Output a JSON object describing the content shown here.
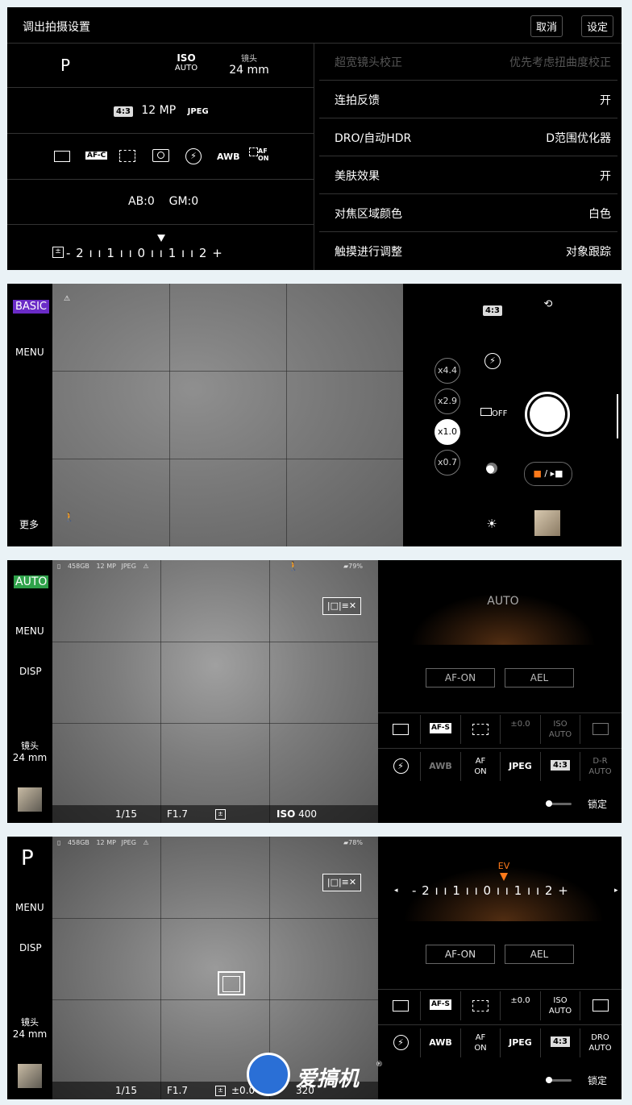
{
  "panel1": {
    "title": "调出拍摄设置",
    "cancel": "取消",
    "set": "设定",
    "mode": "P",
    "iso_label": "ISO",
    "iso_value": "AUTO",
    "lens_label": "镜头",
    "lens_value": "24 mm",
    "aspect": "4:3",
    "megapixels": "12 MP",
    "format": "JPEG",
    "afc": "AF-C",
    "awb": "AWB",
    "af_on_label": "AF\nON",
    "white_balance_shift": "AB:0    GM:0",
    "ev_scale": "- 2 ı ı 1 ı ı 0 ı ı 1 ı ı 2 +",
    "settings": [
      {
        "label": "超宽镜头校正",
        "value": "优先考虑扭曲度校正",
        "disabled": true
      },
      {
        "label": "连拍反馈",
        "value": "开",
        "disabled": false
      },
      {
        "label": "DRO/自动HDR",
        "value": "D范围优化器",
        "disabled": false
      },
      {
        "label": "美肤效果",
        "value": "开",
        "disabled": false
      },
      {
        "label": "对焦区域颜色",
        "value": "白色",
        "disabled": false
      },
      {
        "label": "触摸进行调整",
        "value": "对象跟踪",
        "disabled": false
      }
    ]
  },
  "panel2": {
    "mode_badge": "BASIC",
    "menu": "MENU",
    "more": "更多",
    "aspect": "4:3",
    "zooms": [
      "x4.4",
      "x2.9",
      "x1.0",
      "x0.7"
    ],
    "active_zoom": "x1.0",
    "drive_off": "OFF",
    "switch_label": "/"
  },
  "panel3": {
    "mode_badge": "AUTO",
    "menu": "MENU",
    "disp": "DISP",
    "lens_label": "镜头",
    "lens_value": "24 mm",
    "storage": "458GB",
    "megapixels": "12 MP",
    "format": "JPEG",
    "battery": "79%",
    "shutter": "1/15",
    "aperture": "F1.7",
    "iso_label": "ISO",
    "iso_value": "400",
    "dial_label": "AUTO",
    "af_on": "AF-ON",
    "ael": "AEL",
    "lock": "锁定",
    "fn_row1": [
      "",
      "AF-S",
      "",
      "±0.0",
      "ISO\nAUTO",
      ""
    ],
    "fn_row2": [
      "",
      "AWB",
      "AF\nON",
      "JPEG",
      "4:3",
      "D-R\nAUTO"
    ]
  },
  "panel4": {
    "mode": "P",
    "menu": "MENU",
    "disp": "DISP",
    "lens_label": "镜头",
    "lens_value": "24 mm",
    "storage": "458GB",
    "megapixels": "12 MP",
    "format": "JPEG",
    "battery": "78%",
    "shutter": "1/15",
    "aperture": "F1.7",
    "ev": "±0.0",
    "iso_value": "320",
    "ev_title": "EV",
    "ev_scale": "- 2 ı ı 1 ı ı 0 ı ı 1 ı ı 2 +",
    "af_on": "AF-ON",
    "ael": "AEL",
    "lock": "锁定",
    "fn_row1": [
      "",
      "AF-S",
      "",
      "±0.0",
      "ISO\nAUTO",
      ""
    ],
    "fn_row2": [
      "",
      "AWB",
      "AF\nON",
      "JPEG",
      "4:3",
      "DRO\nAUTO"
    ],
    "watermark": "爱搞机",
    "watermark_mark": "®"
  },
  "colors": {
    "basic_badge": "#6a2bc6",
    "auto_badge": "#2fa24a",
    "ev_marker": "#ff7a1a",
    "page_bg": "#eaf2f6"
  }
}
